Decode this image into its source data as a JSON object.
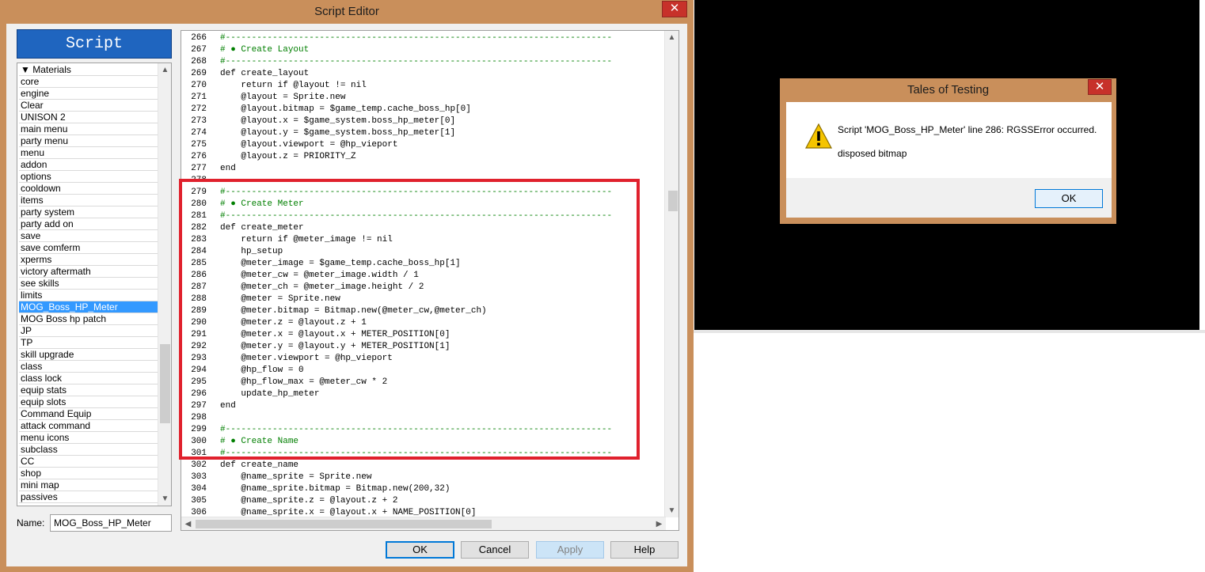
{
  "editor": {
    "title": "Script Editor",
    "close": "✕",
    "header": "Script",
    "scripts": [
      "▼ Materials",
      "core",
      "engine",
      "Clear",
      "UNISON 2",
      "main menu",
      "party menu",
      "menu",
      "addon",
      "options",
      "cooldown",
      "items",
      "party system",
      "party add on",
      "save",
      "save comferm",
      "xperms",
      "victory aftermath",
      "see skills",
      "limits",
      "MOG_Boss_HP_Meter",
      "MOG Boss hp patch",
      "JP",
      "TP",
      "skill upgrade",
      "class",
      "class lock",
      "equip stats",
      "equip slots",
      "Command Equip",
      "attack command",
      "menu icons",
      "subclass",
      "CC",
      "shop",
      "mini map",
      "passives"
    ],
    "selected_script": "MOG_Boss_HP_Meter",
    "name_label": "Name:",
    "name_value": "MOG_Boss_HP_Meter",
    "buttons": {
      "ok": "OK",
      "cancel": "Cancel",
      "apply": "Apply",
      "help": "Help"
    },
    "code": [
      {
        "n": "266",
        "t": "#--------------------------------------------------------------------------",
        "c": "green"
      },
      {
        "n": "267",
        "t": "# ● Create Layout",
        "c": "green"
      },
      {
        "n": "268",
        "t": "#--------------------------------------------------------------------------",
        "c": "green"
      },
      {
        "n": "269",
        "t": "def create_layout",
        "c": ""
      },
      {
        "n": "270",
        "t": "    return if @layout != nil",
        "c": ""
      },
      {
        "n": "271",
        "t": "    @layout = Sprite.new",
        "c": ""
      },
      {
        "n": "272",
        "t": "    @layout.bitmap = $game_temp.cache_boss_hp[0]",
        "c": ""
      },
      {
        "n": "273",
        "t": "    @layout.x = $game_system.boss_hp_meter[0]",
        "c": ""
      },
      {
        "n": "274",
        "t": "    @layout.y = $game_system.boss_hp_meter[1]",
        "c": ""
      },
      {
        "n": "275",
        "t": "    @layout.viewport = @hp_vieport",
        "c": ""
      },
      {
        "n": "276",
        "t": "    @layout.z = PRIORITY_Z",
        "c": ""
      },
      {
        "n": "277",
        "t": "end",
        "c": ""
      },
      {
        "n": "278",
        "t": "",
        "c": ""
      },
      {
        "n": "279",
        "t": "#--------------------------------------------------------------------------",
        "c": "green"
      },
      {
        "n": "280",
        "t": "# ● Create Meter",
        "c": "green"
      },
      {
        "n": "281",
        "t": "#--------------------------------------------------------------------------",
        "c": "green"
      },
      {
        "n": "282",
        "t": "def create_meter",
        "c": ""
      },
      {
        "n": "283",
        "t": "    return if @meter_image != nil",
        "c": ""
      },
      {
        "n": "284",
        "t": "    hp_setup",
        "c": ""
      },
      {
        "n": "285",
        "t": "    @meter_image = $game_temp.cache_boss_hp[1]",
        "c": ""
      },
      {
        "n": "286",
        "t": "    @meter_cw = @meter_image.width / 1",
        "c": ""
      },
      {
        "n": "287",
        "t": "    @meter_ch = @meter_image.height / 2",
        "c": ""
      },
      {
        "n": "288",
        "t": "    @meter = Sprite.new",
        "c": ""
      },
      {
        "n": "289",
        "t": "    @meter.bitmap = Bitmap.new(@meter_cw,@meter_ch)",
        "c": ""
      },
      {
        "n": "290",
        "t": "    @meter.z = @layout.z + 1",
        "c": ""
      },
      {
        "n": "291",
        "t": "    @meter.x = @layout.x + METER_POSITION[0]",
        "c": ""
      },
      {
        "n": "292",
        "t": "    @meter.y = @layout.y + METER_POSITION[1]",
        "c": ""
      },
      {
        "n": "293",
        "t": "    @meter.viewport = @hp_vieport",
        "c": ""
      },
      {
        "n": "294",
        "t": "    @hp_flow = 0",
        "c": ""
      },
      {
        "n": "295",
        "t": "    @hp_flow_max = @meter_cw * 2",
        "c": ""
      },
      {
        "n": "296",
        "t": "    update_hp_meter",
        "c": ""
      },
      {
        "n": "297",
        "t": "end",
        "c": ""
      },
      {
        "n": "298",
        "t": "",
        "c": ""
      },
      {
        "n": "299",
        "t": "#--------------------------------------------------------------------------",
        "c": "green"
      },
      {
        "n": "300",
        "t": "# ● Create Name",
        "c": "green"
      },
      {
        "n": "301",
        "t": "#--------------------------------------------------------------------------",
        "c": "green"
      },
      {
        "n": "302",
        "t": "def create_name",
        "c": ""
      },
      {
        "n": "303",
        "t": "    @name_sprite = Sprite.new",
        "c": ""
      },
      {
        "n": "304",
        "t": "    @name_sprite.bitmap = Bitmap.new(200,32)",
        "c": ""
      },
      {
        "n": "305",
        "t": "    @name_sprite.z = @layout.z + 2",
        "c": ""
      },
      {
        "n": "306",
        "t": "    @name_sprite.x = @layout.x + NAME_POSITION[0]",
        "c": ""
      }
    ]
  },
  "dialog": {
    "title": "Tales of Testing",
    "close": "✕",
    "message": "Script 'MOG_Boss_HP_Meter' line 286: RGSSError occurred.",
    "detail": "disposed bitmap",
    "ok": "OK"
  },
  "colors": {
    "title_bar": "#c98f5b",
    "close_button": "#c7312a",
    "selection": "#3399ff",
    "highlight_box": "#e0212d",
    "comment": "#007f00"
  }
}
